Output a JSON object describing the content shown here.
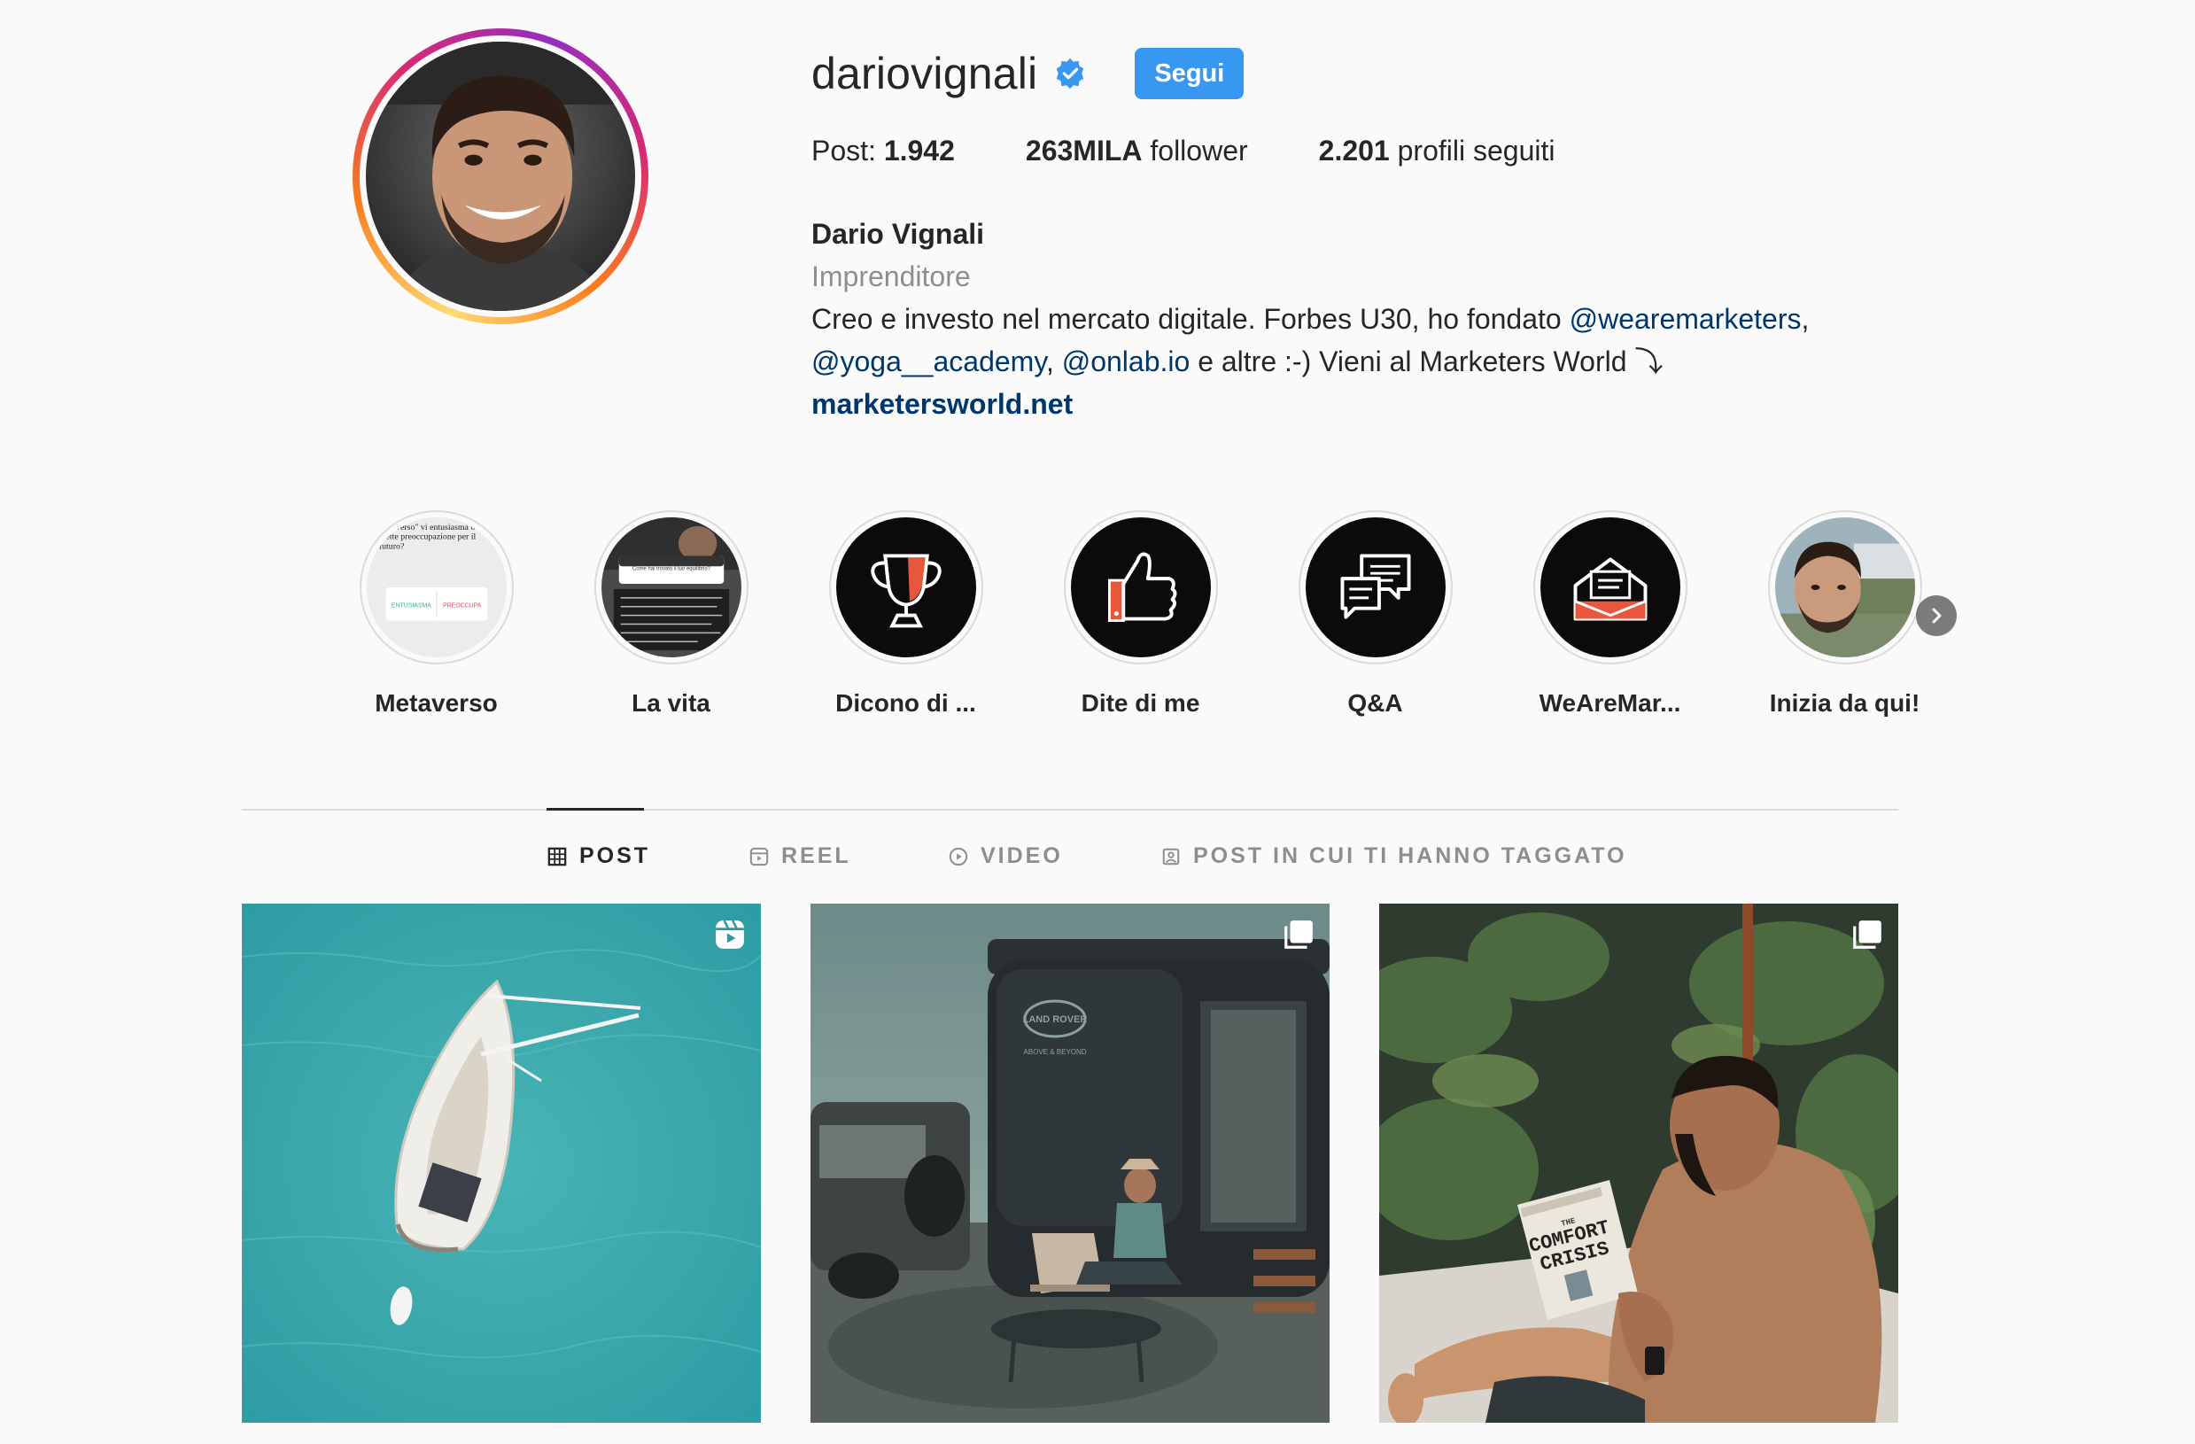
{
  "profile": {
    "username": "dariovignali",
    "follow_label": "Segui",
    "colors": {
      "accent": "#3897f0",
      "verified": "#3897f0",
      "link": "#00376b",
      "muted": "#8e8e8e"
    },
    "stats": {
      "posts_label": "Post: ",
      "posts_value": "1.942",
      "followers_value": "263MILA",
      "followers_label": " follower",
      "following_value": "2.201",
      "following_label": " profili seguiti"
    },
    "bio": {
      "full_name": "Dario Vignali",
      "category": "Imprenditore",
      "line1_text": "Creo e investo nel mercato digitale. Forbes U30, ho fondato ",
      "mention1": "@wearemarketers",
      "comma1": ",",
      "mention2": "@yoga__academy",
      "comma2": ", ",
      "mention3": "@onlab.io",
      "line2_text": " e altre :-) Vieni al Marketers World ⤵",
      "website": "marketersworld.net"
    }
  },
  "highlights": [
    {
      "label": "Metaverso",
      "icon": "poll-story"
    },
    {
      "label": "La vita",
      "icon": "question-story"
    },
    {
      "label": "Dicono di ...",
      "icon": "trophy-icon"
    },
    {
      "label": "Dite di me",
      "icon": "thumbs-up-icon"
    },
    {
      "label": "Q&A",
      "icon": "chat-bubbles-icon"
    },
    {
      "label": "WeAreMar...",
      "icon": "envelope-icon"
    },
    {
      "label": "Inizia da qui!",
      "icon": "selfie-photo"
    }
  ],
  "tabs": [
    {
      "label": "POST",
      "icon": "grid-icon",
      "active": true
    },
    {
      "label": "REEL",
      "icon": "reel-icon",
      "active": false
    },
    {
      "label": "VIDEO",
      "icon": "play-icon",
      "active": false
    },
    {
      "label": "POST IN CUI TI HANNO TAGGATO",
      "icon": "tagged-icon",
      "active": false
    }
  ],
  "posts": [
    {
      "type": "reel",
      "badge_icon": "reel-icon"
    },
    {
      "type": "carousel",
      "badge_icon": "carousel-icon"
    },
    {
      "type": "carousel",
      "badge_icon": "carousel-icon"
    }
  ],
  "post_texts": {
    "camper_brand": "LAND ROVER",
    "camper_tagline": "ABOVE & BEYOND",
    "book_line1": "THE",
    "book_line2": "COMFORT",
    "book_line3": "CRISIS"
  },
  "story_texts": {
    "poll_question": "metaverso\" vi entusiasma o vi mette preoccupazione per il futuro?",
    "poll_option1": "ENTUSIASMA",
    "poll_option2": "PREOCCUPA",
    "question_prompt": "Come hai trovato il tuo equilibrio?"
  }
}
